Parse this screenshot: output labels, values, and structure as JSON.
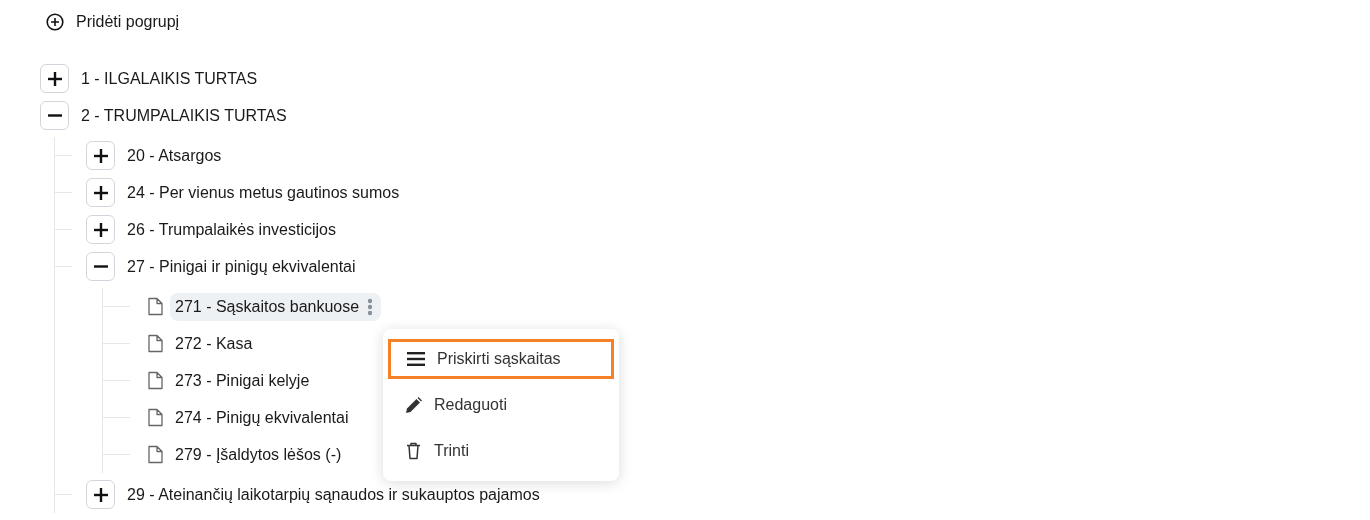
{
  "add_button": {
    "label": "Pridėti pogrupį"
  },
  "tree": [
    {
      "kind": "group",
      "label": "1 - ILGALAIKIS TURTAS",
      "expanded": false
    },
    {
      "kind": "group",
      "label": "2 - TRUMPALAIKIS TURTAS",
      "expanded": true,
      "children": [
        {
          "kind": "group",
          "label": "20 - Atsargos",
          "expanded": false
        },
        {
          "kind": "group",
          "label": "24 - Per vienus metus gautinos sumos",
          "expanded": false
        },
        {
          "kind": "group",
          "label": "26 - Trumpalaikės investicijos",
          "expanded": false
        },
        {
          "kind": "group",
          "label": "27 - Pinigai ir pinigų ekvivalentai",
          "expanded": true,
          "children": [
            {
              "kind": "leaf",
              "label": "271 - Sąskaitos bankuose",
              "active": true
            },
            {
              "kind": "leaf",
              "label": "272 - Kasa",
              "active": false
            },
            {
              "kind": "leaf",
              "label": "273 - Pinigai kelyje",
              "active": false
            },
            {
              "kind": "leaf",
              "label": "274 - Pinigų ekvivalentai",
              "active": false
            },
            {
              "kind": "leaf",
              "label": "279 - Įšaldytos lėšos (-)",
              "active": false
            }
          ]
        },
        {
          "kind": "group",
          "label": "29 - Ateinančių laikotarpių sąnaudos ir sukauptos pajamos",
          "expanded": false
        }
      ]
    }
  ],
  "context_menu": [
    {
      "kind": "assign",
      "label": "Priskirti sąskaitas",
      "selected": true
    },
    {
      "kind": "edit",
      "label": "Redaguoti",
      "selected": false
    },
    {
      "kind": "delete",
      "label": "Trinti",
      "selected": false
    }
  ]
}
